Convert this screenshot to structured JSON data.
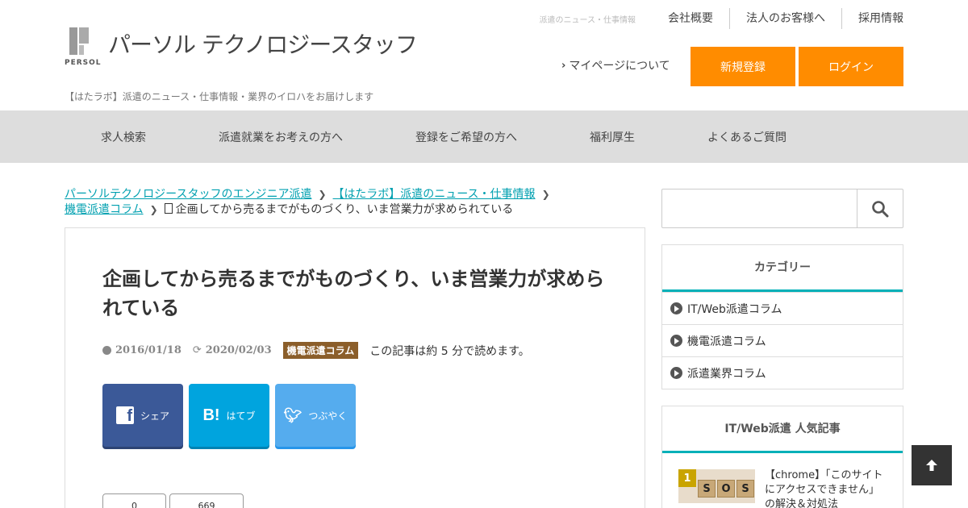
{
  "header": {
    "logo_small": "PERSOL",
    "logo_name": "パーソル テクノロジースタッフ",
    "tagline": "【はたラボ】派遣のニュース・仕事情報・業界のイロハをお届けします",
    "top_small": "派遣のニュース・仕事情報",
    "top_links": [
      "会社概要",
      "法人のお客様へ",
      "採用情報"
    ],
    "mypage": "マイページについて",
    "register": "新規登録",
    "login": "ログイン",
    "accent": "#ff8c00"
  },
  "nav": {
    "items": [
      "求人検索",
      "派遣就業をお考えの方へ",
      "登録をご希望の方へ",
      "福利厚生",
      "よくあるご質問"
    ]
  },
  "breadcrumb": {
    "items": [
      "パーソルテクノロジースタッフのエンジニア派遣",
      "【はたラボ】派遣のニュース・仕事情報",
      "機電派遣コラム"
    ],
    "current": "企画してから売るまでがものづくり、いま営業力が求められている"
  },
  "article": {
    "title": "企画してから売るまでがものづくり、いま営業力が求められている",
    "published": "2016/01/18",
    "updated": "2020/02/03",
    "category": "機電派遣コラム",
    "read_time": "この記事は約 5 分で読めます。",
    "share": {
      "facebook": "シェア",
      "hatena": "はてブ",
      "twitter": "つぶやく"
    },
    "counts": [
      "0",
      "669"
    ]
  },
  "sidebar": {
    "search_placeholder": "",
    "categories_title": "カテゴリー",
    "categories": [
      "IT/Web派遣コラム",
      "機電派遣コラム",
      "派遣業界コラム"
    ],
    "popular_title": "IT/Web派遣 人気記事",
    "popular": [
      {
        "rank": "1",
        "thumb_letters": [
          "S",
          "O",
          "S"
        ],
        "text": "【chrome】「このサイトにアクセスできません」の解決＆対処法"
      }
    ],
    "accent": "#00b0b8"
  }
}
